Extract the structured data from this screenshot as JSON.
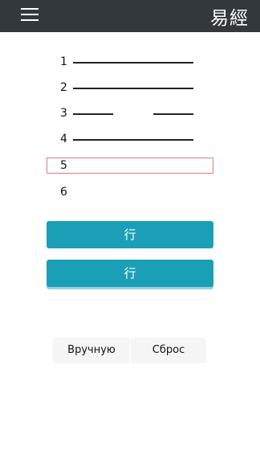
{
  "header": {
    "menu_icon": "hamburger-menu-icon",
    "brand": "易經",
    "background": "#33383d"
  },
  "hexagram": {
    "lines": [
      {
        "number": "1",
        "type": "yang"
      },
      {
        "number": "2",
        "type": "yang"
      },
      {
        "number": "3",
        "type": "yin"
      },
      {
        "number": "4",
        "type": "yang"
      },
      {
        "number": "5",
        "type": "empty",
        "active": true
      },
      {
        "number": "6",
        "type": "empty"
      }
    ]
  },
  "actions": {
    "primary_label_1": "行",
    "primary_label_2": "行",
    "primary_color": "#1a9fb6",
    "manual_label": "Вручную",
    "reset_label": "Сброс"
  }
}
